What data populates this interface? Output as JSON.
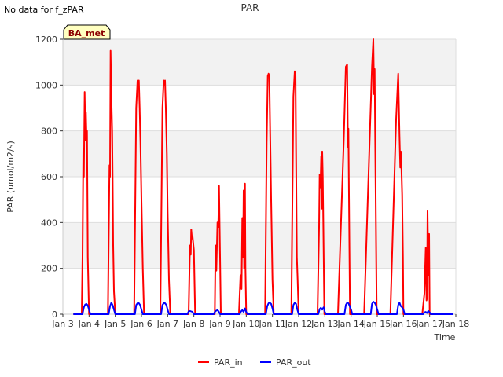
{
  "note": "No data for f_zPAR",
  "site_tag": "BA_met",
  "chart_data": {
    "type": "line",
    "title": "PAR",
    "xlabel": "Time",
    "ylabel": "PAR (umol/m2/s)",
    "xlim": [
      3,
      18
    ],
    "ylim": [
      0,
      1200
    ],
    "x_ticks": [
      3,
      4,
      5,
      6,
      7,
      8,
      9,
      10,
      11,
      12,
      13,
      14,
      15,
      16,
      17,
      18
    ],
    "x_tick_labels": [
      "Jan 3",
      "Jan 4",
      "Jan 5",
      "Jan 6",
      "Jan 7",
      "Jan 8",
      "Jan 9",
      "Jan 10",
      "Jan 11",
      "Jan 12",
      "Jan 13",
      "Jan 14",
      "Jan 15",
      "Jan 16",
      "Jan 17",
      "Jan 18"
    ],
    "y_ticks": [
      0,
      200,
      400,
      600,
      800,
      1000,
      1200
    ],
    "y_tick_labels": [
      "0",
      "200",
      "400",
      "600",
      "800",
      "1000",
      "1200"
    ],
    "grid": true,
    "legend_position": "bottom-center",
    "series": [
      {
        "name": "PAR_in",
        "color": "#ff0000",
        "x": [
          3.4,
          3.72,
          3.75,
          3.78,
          3.8,
          3.83,
          3.86,
          3.88,
          3.9,
          3.92,
          3.95,
          4.0,
          4.05,
          4.1,
          4.15,
          4.5,
          4.72,
          4.78,
          4.8,
          4.82,
          4.85,
          4.88,
          4.9,
          4.92,
          4.95,
          5.0,
          5.1,
          5.2,
          5.5,
          5.72,
          5.8,
          5.85,
          5.88,
          5.9,
          5.93,
          5.96,
          6.0,
          6.05,
          6.1,
          6.15,
          6.5,
          6.72,
          6.8,
          6.85,
          6.88,
          6.9,
          6.93,
          6.97,
          7.0,
          7.05,
          7.1,
          7.15,
          7.5,
          7.72,
          7.8,
          7.85,
          7.88,
          7.9,
          7.93,
          7.95,
          8.0,
          8.05,
          8.1,
          8.5,
          8.72,
          8.8,
          8.83,
          8.86,
          8.9,
          8.93,
          8.96,
          9.0,
          9.03,
          9.06,
          9.1,
          9.5,
          9.72,
          9.78,
          9.82,
          9.85,
          9.88,
          9.9,
          9.92,
          9.95,
          9.97,
          10.0,
          10.05,
          10.1,
          10.5,
          10.72,
          10.78,
          10.82,
          10.85,
          10.88,
          10.9,
          10.95,
          11.0,
          11.05,
          11.1,
          11.15,
          11.5,
          11.72,
          11.8,
          11.85,
          11.88,
          11.9,
          11.93,
          11.96,
          12.0,
          12.05,
          12.1,
          12.15,
          12.5,
          12.72,
          12.78,
          12.8,
          12.83,
          12.86,
          12.88,
          12.9,
          12.92,
          12.95,
          12.98,
          13.0,
          13.05,
          13.1,
          13.15,
          13.5,
          13.72,
          13.8,
          13.85,
          13.88,
          13.9,
          13.93,
          13.96,
          14.0,
          14.05,
          14.1,
          14.15,
          14.5,
          14.72,
          14.8,
          14.85,
          14.88,
          14.9,
          14.92,
          14.95,
          14.98,
          15.0,
          15.05,
          15.1,
          15.15,
          15.5,
          15.72,
          15.8,
          15.85,
          15.88,
          15.9,
          15.92,
          15.95,
          15.98,
          16.0,
          16.05,
          16.1,
          16.15,
          16.5,
          16.72,
          16.8,
          16.85,
          16.88,
          16.9,
          16.92,
          16.95,
          16.98,
          17.0,
          17.05,
          17.1,
          17.15,
          17.5,
          17.88
        ],
        "y": [
          0,
          0,
          250,
          720,
          600,
          970,
          760,
          880,
          780,
          800,
          250,
          0,
          0,
          0,
          0,
          0,
          0,
          650,
          600,
          1150,
          950,
          800,
          600,
          300,
          100,
          0,
          0,
          0,
          0,
          0,
          900,
          1020,
          1000,
          1020,
          900,
          750,
          500,
          200,
          0,
          0,
          0,
          0,
          900,
          1020,
          1000,
          1020,
          900,
          700,
          450,
          150,
          0,
          0,
          0,
          0,
          0,
          300,
          260,
          370,
          330,
          340,
          280,
          0,
          0,
          0,
          0,
          0,
          300,
          190,
          400,
          380,
          560,
          250,
          0,
          0,
          0,
          0,
          0,
          170,
          110,
          420,
          250,
          540,
          200,
          570,
          200,
          0,
          0,
          0,
          0,
          0,
          750,
          1040,
          1050,
          1040,
          900,
          500,
          150,
          0,
          0,
          0,
          0,
          0,
          950,
          1060,
          1050,
          700,
          250,
          150,
          0,
          0,
          0,
          0,
          0,
          0,
          380,
          610,
          550,
          690,
          460,
          710,
          600,
          300,
          0,
          0,
          0,
          0,
          0,
          0,
          750,
          1080,
          1090,
          730,
          810,
          400,
          0,
          0,
          0,
          0,
          0,
          0,
          800,
          1080,
          1200,
          960,
          1070,
          800,
          400,
          0,
          0,
          0,
          0,
          0,
          0,
          850,
          1050,
          780,
          640,
          710,
          650,
          520,
          250,
          0,
          0,
          0,
          0,
          0,
          0,
          90,
          290,
          60,
          70,
          450,
          170,
          350,
          0,
          0,
          0,
          0,
          0,
          0
        ]
      },
      {
        "name": "PAR_out",
        "color": "#0000ff",
        "x": [
          3.4,
          3.75,
          3.8,
          3.85,
          3.9,
          3.95,
          4.0,
          4.05,
          4.1,
          4.15,
          4.5,
          4.75,
          4.8,
          4.85,
          4.9,
          4.95,
          5.0,
          5.1,
          5.2,
          5.5,
          5.75,
          5.8,
          5.85,
          5.9,
          5.95,
          6.0,
          6.05,
          6.1,
          6.15,
          6.5,
          6.75,
          6.8,
          6.85,
          6.9,
          6.95,
          7.0,
          7.05,
          7.1,
          7.15,
          7.5,
          7.75,
          7.8,
          7.85,
          7.9,
          7.95,
          8.0,
          8.05,
          8.1,
          8.5,
          8.75,
          8.8,
          8.85,
          8.9,
          8.95,
          9.0,
          9.05,
          9.1,
          9.5,
          9.75,
          9.8,
          9.85,
          9.9,
          9.95,
          10.0,
          10.05,
          10.1,
          10.5,
          10.75,
          10.8,
          10.85,
          10.9,
          10.95,
          11.0,
          11.05,
          11.1,
          11.15,
          11.5,
          11.75,
          11.8,
          11.85,
          11.9,
          11.95,
          12.0,
          12.05,
          12.1,
          12.15,
          12.5,
          12.75,
          12.8,
          12.85,
          12.9,
          12.95,
          13.0,
          13.05,
          13.1,
          13.15,
          13.5,
          13.75,
          13.8,
          13.85,
          13.9,
          13.95,
          14.0,
          14.05,
          14.1,
          14.15,
          14.5,
          14.75,
          14.8,
          14.85,
          14.9,
          14.95,
          15.0,
          15.05,
          15.1,
          15.15,
          15.5,
          15.75,
          15.8,
          15.85,
          15.9,
          15.95,
          16.0,
          16.05,
          16.1,
          16.15,
          16.5,
          16.75,
          16.8,
          16.85,
          16.9,
          16.95,
          17.0,
          17.05,
          17.1,
          17.15,
          17.5,
          17.88
        ],
        "y": [
          0,
          0,
          30,
          42,
          45,
          38,
          20,
          0,
          0,
          0,
          0,
          0,
          35,
          50,
          40,
          20,
          0,
          0,
          0,
          0,
          0,
          40,
          48,
          48,
          40,
          20,
          0,
          0,
          0,
          0,
          0,
          40,
          48,
          48,
          40,
          20,
          0,
          0,
          0,
          0,
          0,
          12,
          14,
          12,
          10,
          0,
          0,
          0,
          0,
          0,
          10,
          15,
          18,
          12,
          0,
          0,
          0,
          0,
          0,
          12,
          18,
          10,
          25,
          10,
          0,
          0,
          0,
          0,
          35,
          48,
          50,
          45,
          25,
          0,
          0,
          0,
          0,
          0,
          40,
          50,
          45,
          20,
          0,
          0,
          0,
          0,
          0,
          0,
          22,
          28,
          20,
          30,
          10,
          0,
          0,
          0,
          0,
          0,
          40,
          50,
          48,
          35,
          20,
          0,
          0,
          0,
          0,
          0,
          45,
          55,
          50,
          40,
          20,
          0,
          0,
          0,
          0,
          0,
          40,
          50,
          35,
          30,
          20,
          0,
          0,
          0,
          0,
          0,
          8,
          10,
          5,
          14,
          8,
          0,
          0,
          0,
          0,
          0
        ]
      }
    ]
  }
}
